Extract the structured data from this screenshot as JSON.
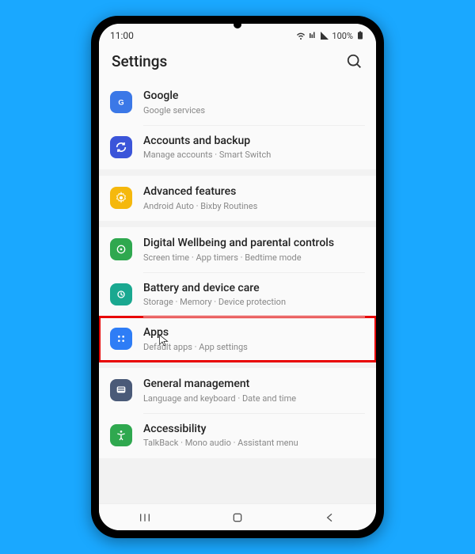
{
  "status": {
    "time": "11:00",
    "battery_text": "100%"
  },
  "header": {
    "title": "Settings"
  },
  "items": {
    "google": {
      "title": "Google",
      "sub": "Google services"
    },
    "accounts": {
      "title": "Accounts and backup",
      "sub": "Manage accounts · Smart Switch"
    },
    "advanced": {
      "title": "Advanced features",
      "sub": "Android Auto · Bixby Routines"
    },
    "wellbeing": {
      "title": "Digital Wellbeing and parental controls",
      "sub": "Screen time · App timers · Bedtime mode"
    },
    "battery": {
      "title": "Battery and device care",
      "sub": "Storage · Memory · Device protection"
    },
    "apps": {
      "title": "Apps",
      "sub": "Default apps · App settings"
    },
    "general": {
      "title": "General management",
      "sub": "Language and keyboard · Date and time"
    },
    "accessibility": {
      "title": "Accessibility",
      "sub": "TalkBack · Mono audio · Assistant menu"
    }
  },
  "colors": {
    "google": "#3b78e7",
    "accounts": "#3b55d9",
    "advanced": "#f5b80d",
    "wellbeing": "#2fa84f",
    "battery": "#1aa890",
    "apps": "#2e7df6",
    "general": "#4a5a78",
    "accessibility": "#2fa84f"
  }
}
